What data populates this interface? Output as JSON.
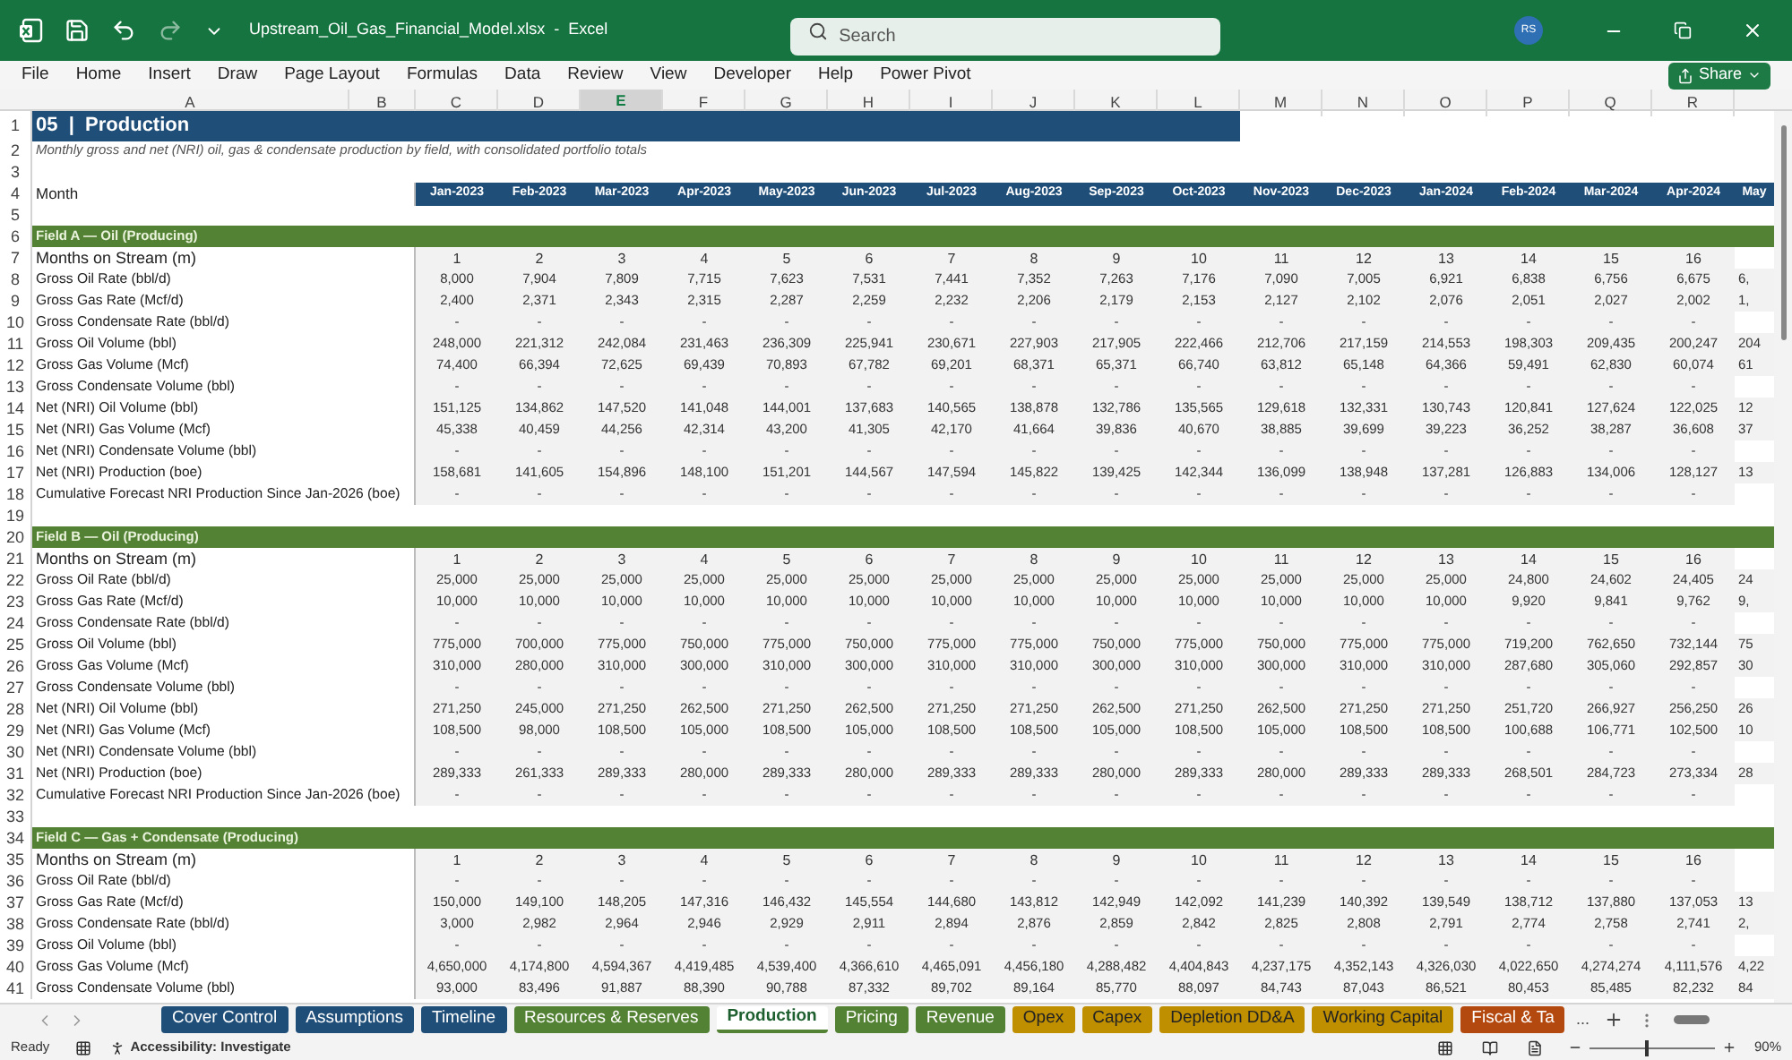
{
  "window": {
    "title": "Upstream_Oil_Gas_Financial_Model.xlsx  -  Excel",
    "search": {
      "placeholder": "Search"
    },
    "avatar": "RS"
  },
  "menu": [
    "File",
    "Home",
    "Insert",
    "Draw",
    "Page Layout",
    "Formulas",
    "Data",
    "Review",
    "View",
    "Developer",
    "Help",
    "Power Pivot"
  ],
  "share": "Share",
  "columns": [
    {
      "label": "A",
      "selected": false
    },
    {
      "label": "B",
      "selected": false
    },
    {
      "label": "C",
      "selected": false
    },
    {
      "label": "D",
      "selected": false
    },
    {
      "label": "E",
      "selected": true
    },
    {
      "label": "F",
      "selected": false
    },
    {
      "label": "G",
      "selected": false
    },
    {
      "label": "H",
      "selected": false
    },
    {
      "label": "I",
      "selected": false
    },
    {
      "label": "J",
      "selected": false
    },
    {
      "label": "K",
      "selected": false
    },
    {
      "label": "L",
      "selected": false
    },
    {
      "label": "M",
      "selected": false
    },
    {
      "label": "N",
      "selected": false
    },
    {
      "label": "O",
      "selected": false
    },
    {
      "label": "P",
      "selected": false
    },
    {
      "label": "Q",
      "selected": false
    },
    {
      "label": "R",
      "selected": false
    }
  ],
  "rows": [
    {
      "kind": "title",
      "num": "1",
      "text": "05  |  Production"
    },
    {
      "kind": "note",
      "num": "2",
      "text": "Monthly gross and net (NRI) oil, gas & condensate production by field, with consolidated portfolio totals"
    },
    {
      "kind": "blank",
      "num": "3"
    },
    {
      "kind": "header",
      "num": "4",
      "label": "Month",
      "values": [
        "Jan-2023",
        "Feb-2023",
        "Mar-2023",
        "Apr-2023",
        "May-2023",
        "Jun-2023",
        "Jul-2023",
        "Aug-2023",
        "Sep-2023",
        "Oct-2023",
        "Nov-2023",
        "Dec-2023",
        "Jan-2024",
        "Feb-2024",
        "Mar-2024",
        "Apr-2024",
        "May"
      ]
    },
    {
      "kind": "blank",
      "num": "5"
    },
    {
      "kind": "section",
      "num": "6",
      "label": "Field A — Oil (Producing)"
    },
    {
      "kind": "months",
      "num": "7",
      "label": "Months on Stream (m)",
      "values": [
        "1",
        "2",
        "3",
        "4",
        "5",
        "6",
        "7",
        "8",
        "9",
        "10",
        "11",
        "12",
        "13",
        "14",
        "15",
        "16"
      ]
    },
    {
      "kind": "data",
      "num": "8",
      "label": "Gross Oil Rate (bbl/d)",
      "values": [
        "8,000",
        "7,904",
        "7,809",
        "7,715",
        "7,623",
        "7,531",
        "7,441",
        "7,352",
        "7,263",
        "7,176",
        "7,090",
        "7,005",
        "6,921",
        "6,838",
        "6,756",
        "6,675",
        "6,"
      ]
    },
    {
      "kind": "data",
      "num": "9",
      "label": "Gross Gas Rate (Mcf/d)",
      "values": [
        "2,400",
        "2,371",
        "2,343",
        "2,315",
        "2,287",
        "2,259",
        "2,232",
        "2,206",
        "2,179",
        "2,153",
        "2,127",
        "2,102",
        "2,076",
        "2,051",
        "2,027",
        "2,002",
        "1,"
      ]
    },
    {
      "kind": "data",
      "num": "10",
      "label": "Gross Condensate Rate (bbl/d)",
      "values": [
        "-",
        "-",
        "-",
        "-",
        "-",
        "-",
        "-",
        "-",
        "-",
        "-",
        "-",
        "-",
        "-",
        "-",
        "-",
        "-"
      ]
    },
    {
      "kind": "data",
      "num": "11",
      "label": "Gross Oil Volume (bbl)",
      "values": [
        "248,000",
        "221,312",
        "242,084",
        "231,463",
        "236,309",
        "225,941",
        "230,671",
        "227,903",
        "217,905",
        "222,466",
        "212,706",
        "217,159",
        "214,553",
        "198,303",
        "209,435",
        "200,247",
        "204"
      ]
    },
    {
      "kind": "data",
      "num": "12",
      "label": "Gross Gas Volume (Mcf)",
      "values": [
        "74,400",
        "66,394",
        "72,625",
        "69,439",
        "70,893",
        "67,782",
        "69,201",
        "68,371",
        "65,371",
        "66,740",
        "63,812",
        "65,148",
        "64,366",
        "59,491",
        "62,830",
        "60,074",
        "61"
      ]
    },
    {
      "kind": "data",
      "num": "13",
      "label": "Gross Condensate Volume (bbl)",
      "values": [
        "-",
        "-",
        "-",
        "-",
        "-",
        "-",
        "-",
        "-",
        "-",
        "-",
        "-",
        "-",
        "-",
        "-",
        "-",
        "-"
      ]
    },
    {
      "kind": "data",
      "num": "14",
      "label": "Net (NRI) Oil Volume (bbl)",
      "values": [
        "151,125",
        "134,862",
        "147,520",
        "141,048",
        "144,001",
        "137,683",
        "140,565",
        "138,878",
        "132,786",
        "135,565",
        "129,618",
        "132,331",
        "130,743",
        "120,841",
        "127,624",
        "122,025",
        "12"
      ]
    },
    {
      "kind": "data",
      "num": "15",
      "label": "Net (NRI) Gas Volume (Mcf)",
      "values": [
        "45,338",
        "40,459",
        "44,256",
        "42,314",
        "43,200",
        "41,305",
        "42,170",
        "41,664",
        "39,836",
        "40,670",
        "38,885",
        "39,699",
        "39,223",
        "36,252",
        "38,287",
        "36,608",
        "37"
      ]
    },
    {
      "kind": "data",
      "num": "16",
      "label": "Net (NRI) Condensate Volume (bbl)",
      "values": [
        "-",
        "-",
        "-",
        "-",
        "-",
        "-",
        "-",
        "-",
        "-",
        "-",
        "-",
        "-",
        "-",
        "-",
        "-",
        "-"
      ]
    },
    {
      "kind": "data",
      "num": "17",
      "label": "Net (NRI) Production (boe)",
      "values": [
        "158,681",
        "141,605",
        "154,896",
        "148,100",
        "151,201",
        "144,567",
        "147,594",
        "145,822",
        "139,425",
        "142,344",
        "136,099",
        "138,948",
        "137,281",
        "126,883",
        "134,006",
        "128,127",
        "13"
      ]
    },
    {
      "kind": "data",
      "num": "18",
      "label": "Cumulative Forecast NRI Production Since Jan-2026 (boe)",
      "values": [
        "-",
        "-",
        "-",
        "-",
        "-",
        "-",
        "-",
        "-",
        "-",
        "-",
        "-",
        "-",
        "-",
        "-",
        "-",
        "-"
      ]
    },
    {
      "kind": "blank",
      "num": "19"
    },
    {
      "kind": "section",
      "num": "20",
      "label": "Field B — Oil (Producing)"
    },
    {
      "kind": "months",
      "num": "21",
      "label": "Months on Stream (m)",
      "values": [
        "1",
        "2",
        "3",
        "4",
        "5",
        "6",
        "7",
        "8",
        "9",
        "10",
        "11",
        "12",
        "13",
        "14",
        "15",
        "16"
      ]
    },
    {
      "kind": "data",
      "num": "22",
      "label": "Gross Oil Rate (bbl/d)",
      "values": [
        "25,000",
        "25,000",
        "25,000",
        "25,000",
        "25,000",
        "25,000",
        "25,000",
        "25,000",
        "25,000",
        "25,000",
        "25,000",
        "25,000",
        "25,000",
        "24,800",
        "24,602",
        "24,405",
        "24"
      ]
    },
    {
      "kind": "data",
      "num": "23",
      "label": "Gross Gas Rate (Mcf/d)",
      "values": [
        "10,000",
        "10,000",
        "10,000",
        "10,000",
        "10,000",
        "10,000",
        "10,000",
        "10,000",
        "10,000",
        "10,000",
        "10,000",
        "10,000",
        "10,000",
        "9,920",
        "9,841",
        "9,762",
        "9,"
      ]
    },
    {
      "kind": "data",
      "num": "24",
      "label": "Gross Condensate Rate (bbl/d)",
      "values": [
        "-",
        "-",
        "-",
        "-",
        "-",
        "-",
        "-",
        "-",
        "-",
        "-",
        "-",
        "-",
        "-",
        "-",
        "-",
        "-"
      ]
    },
    {
      "kind": "data",
      "num": "25",
      "label": "Gross Oil Volume (bbl)",
      "values": [
        "775,000",
        "700,000",
        "775,000",
        "750,000",
        "775,000",
        "750,000",
        "775,000",
        "775,000",
        "750,000",
        "775,000",
        "750,000",
        "775,000",
        "775,000",
        "719,200",
        "762,650",
        "732,144",
        "75"
      ]
    },
    {
      "kind": "data",
      "num": "26",
      "label": "Gross Gas Volume (Mcf)",
      "values": [
        "310,000",
        "280,000",
        "310,000",
        "300,000",
        "310,000",
        "300,000",
        "310,000",
        "310,000",
        "300,000",
        "310,000",
        "300,000",
        "310,000",
        "310,000",
        "287,680",
        "305,060",
        "292,857",
        "30"
      ]
    },
    {
      "kind": "data",
      "num": "27",
      "label": "Gross Condensate Volume (bbl)",
      "values": [
        "-",
        "-",
        "-",
        "-",
        "-",
        "-",
        "-",
        "-",
        "-",
        "-",
        "-",
        "-",
        "-",
        "-",
        "-",
        "-"
      ]
    },
    {
      "kind": "data",
      "num": "28",
      "label": "Net (NRI) Oil Volume (bbl)",
      "values": [
        "271,250",
        "245,000",
        "271,250",
        "262,500",
        "271,250",
        "262,500",
        "271,250",
        "271,250",
        "262,500",
        "271,250",
        "262,500",
        "271,250",
        "271,250",
        "251,720",
        "266,927",
        "256,250",
        "26"
      ]
    },
    {
      "kind": "data",
      "num": "29",
      "label": "Net (NRI) Gas Volume (Mcf)",
      "values": [
        "108,500",
        "98,000",
        "108,500",
        "105,000",
        "108,500",
        "105,000",
        "108,500",
        "108,500",
        "105,000",
        "108,500",
        "105,000",
        "108,500",
        "108,500",
        "100,688",
        "106,771",
        "102,500",
        "10"
      ]
    },
    {
      "kind": "data",
      "num": "30",
      "label": "Net (NRI) Condensate Volume (bbl)",
      "values": [
        "-",
        "-",
        "-",
        "-",
        "-",
        "-",
        "-",
        "-",
        "-",
        "-",
        "-",
        "-",
        "-",
        "-",
        "-",
        "-"
      ]
    },
    {
      "kind": "data",
      "num": "31",
      "label": "Net (NRI) Production (boe)",
      "values": [
        "289,333",
        "261,333",
        "289,333",
        "280,000",
        "289,333",
        "280,000",
        "289,333",
        "289,333",
        "280,000",
        "289,333",
        "280,000",
        "289,333",
        "289,333",
        "268,501",
        "284,723",
        "273,334",
        "28"
      ]
    },
    {
      "kind": "data",
      "num": "32",
      "label": "Cumulative Forecast NRI Production Since Jan-2026 (boe)",
      "values": [
        "-",
        "-",
        "-",
        "-",
        "-",
        "-",
        "-",
        "-",
        "-",
        "-",
        "-",
        "-",
        "-",
        "-",
        "-",
        "-"
      ]
    },
    {
      "kind": "blank",
      "num": "33"
    },
    {
      "kind": "section",
      "num": "34",
      "label": "Field C — Gas + Condensate (Producing)"
    },
    {
      "kind": "months",
      "num": "35",
      "label": "Months on Stream (m)",
      "values": [
        "1",
        "2",
        "3",
        "4",
        "5",
        "6",
        "7",
        "8",
        "9",
        "10",
        "11",
        "12",
        "13",
        "14",
        "15",
        "16"
      ]
    },
    {
      "kind": "data",
      "num": "36",
      "label": "Gross Oil Rate (bbl/d)",
      "values": [
        "-",
        "-",
        "-",
        "-",
        "-",
        "-",
        "-",
        "-",
        "-",
        "-",
        "-",
        "-",
        "-",
        "-",
        "-",
        "-"
      ]
    },
    {
      "kind": "data",
      "num": "37",
      "label": "Gross Gas Rate (Mcf/d)",
      "values": [
        "150,000",
        "149,100",
        "148,205",
        "147,316",
        "146,432",
        "145,554",
        "144,680",
        "143,812",
        "142,949",
        "142,092",
        "141,239",
        "140,392",
        "139,549",
        "138,712",
        "137,880",
        "137,053",
        "13"
      ]
    },
    {
      "kind": "data",
      "num": "38",
      "label": "Gross Condensate Rate (bbl/d)",
      "values": [
        "3,000",
        "2,982",
        "2,964",
        "2,946",
        "2,929",
        "2,911",
        "2,894",
        "2,876",
        "2,859",
        "2,842",
        "2,825",
        "2,808",
        "2,791",
        "2,774",
        "2,758",
        "2,741",
        "2,"
      ]
    },
    {
      "kind": "data",
      "num": "39",
      "label": "Gross Oil Volume (bbl)",
      "values": [
        "-",
        "-",
        "-",
        "-",
        "-",
        "-",
        "-",
        "-",
        "-",
        "-",
        "-",
        "-",
        "-",
        "-",
        "-",
        "-"
      ]
    },
    {
      "kind": "data",
      "num": "40",
      "label": "Gross Gas Volume (Mcf)",
      "values": [
        "4,650,000",
        "4,174,800",
        "4,594,367",
        "4,419,485",
        "4,539,400",
        "4,366,610",
        "4,465,091",
        "4,456,180",
        "4,288,482",
        "4,404,843",
        "4,237,175",
        "4,352,143",
        "4,326,030",
        "4,022,650",
        "4,274,274",
        "4,111,576",
        "4,22"
      ]
    },
    {
      "kind": "data",
      "num": "41",
      "label": "Gross Condensate Volume (bbl)",
      "values": [
        "93,000",
        "83,496",
        "91,887",
        "88,390",
        "90,788",
        "87,332",
        "89,702",
        "89,164",
        "85,770",
        "88,097",
        "84,743",
        "87,043",
        "86,521",
        "80,453",
        "85,485",
        "82,232",
        "84"
      ]
    }
  ],
  "sheet_tabs": [
    {
      "label": "Cover Control",
      "color": "#1f4e79",
      "selected": false
    },
    {
      "label": "Assumptions",
      "color": "#1f4e79",
      "selected": false
    },
    {
      "label": "Timeline",
      "color": "#1f4e79",
      "selected": false
    },
    {
      "label": "Resources & Reserves",
      "color": "#548235",
      "selected": false
    },
    {
      "label": "Production",
      "color": "#548235",
      "selected": true
    },
    {
      "label": "Pricing",
      "color": "#548235",
      "selected": false
    },
    {
      "label": "Revenue",
      "color": "#548235",
      "selected": false
    },
    {
      "label": "Opex",
      "color": "#bf8f00",
      "selected": false
    },
    {
      "label": "Capex",
      "color": "#bf8f00",
      "selected": false
    },
    {
      "label": "Depletion DD&A",
      "color": "#bf8f00",
      "selected": false
    },
    {
      "label": "Working Capital",
      "color": "#bf8f00",
      "selected": false
    },
    {
      "label": "Fiscal & Ta",
      "color": "#b4490f",
      "selected": false
    }
  ],
  "tab_more": "...",
  "status_bar": {
    "state": "Ready",
    "accessibility": "Accessibility: Investigate",
    "zoom": "90%",
    "level": 0.45
  }
}
